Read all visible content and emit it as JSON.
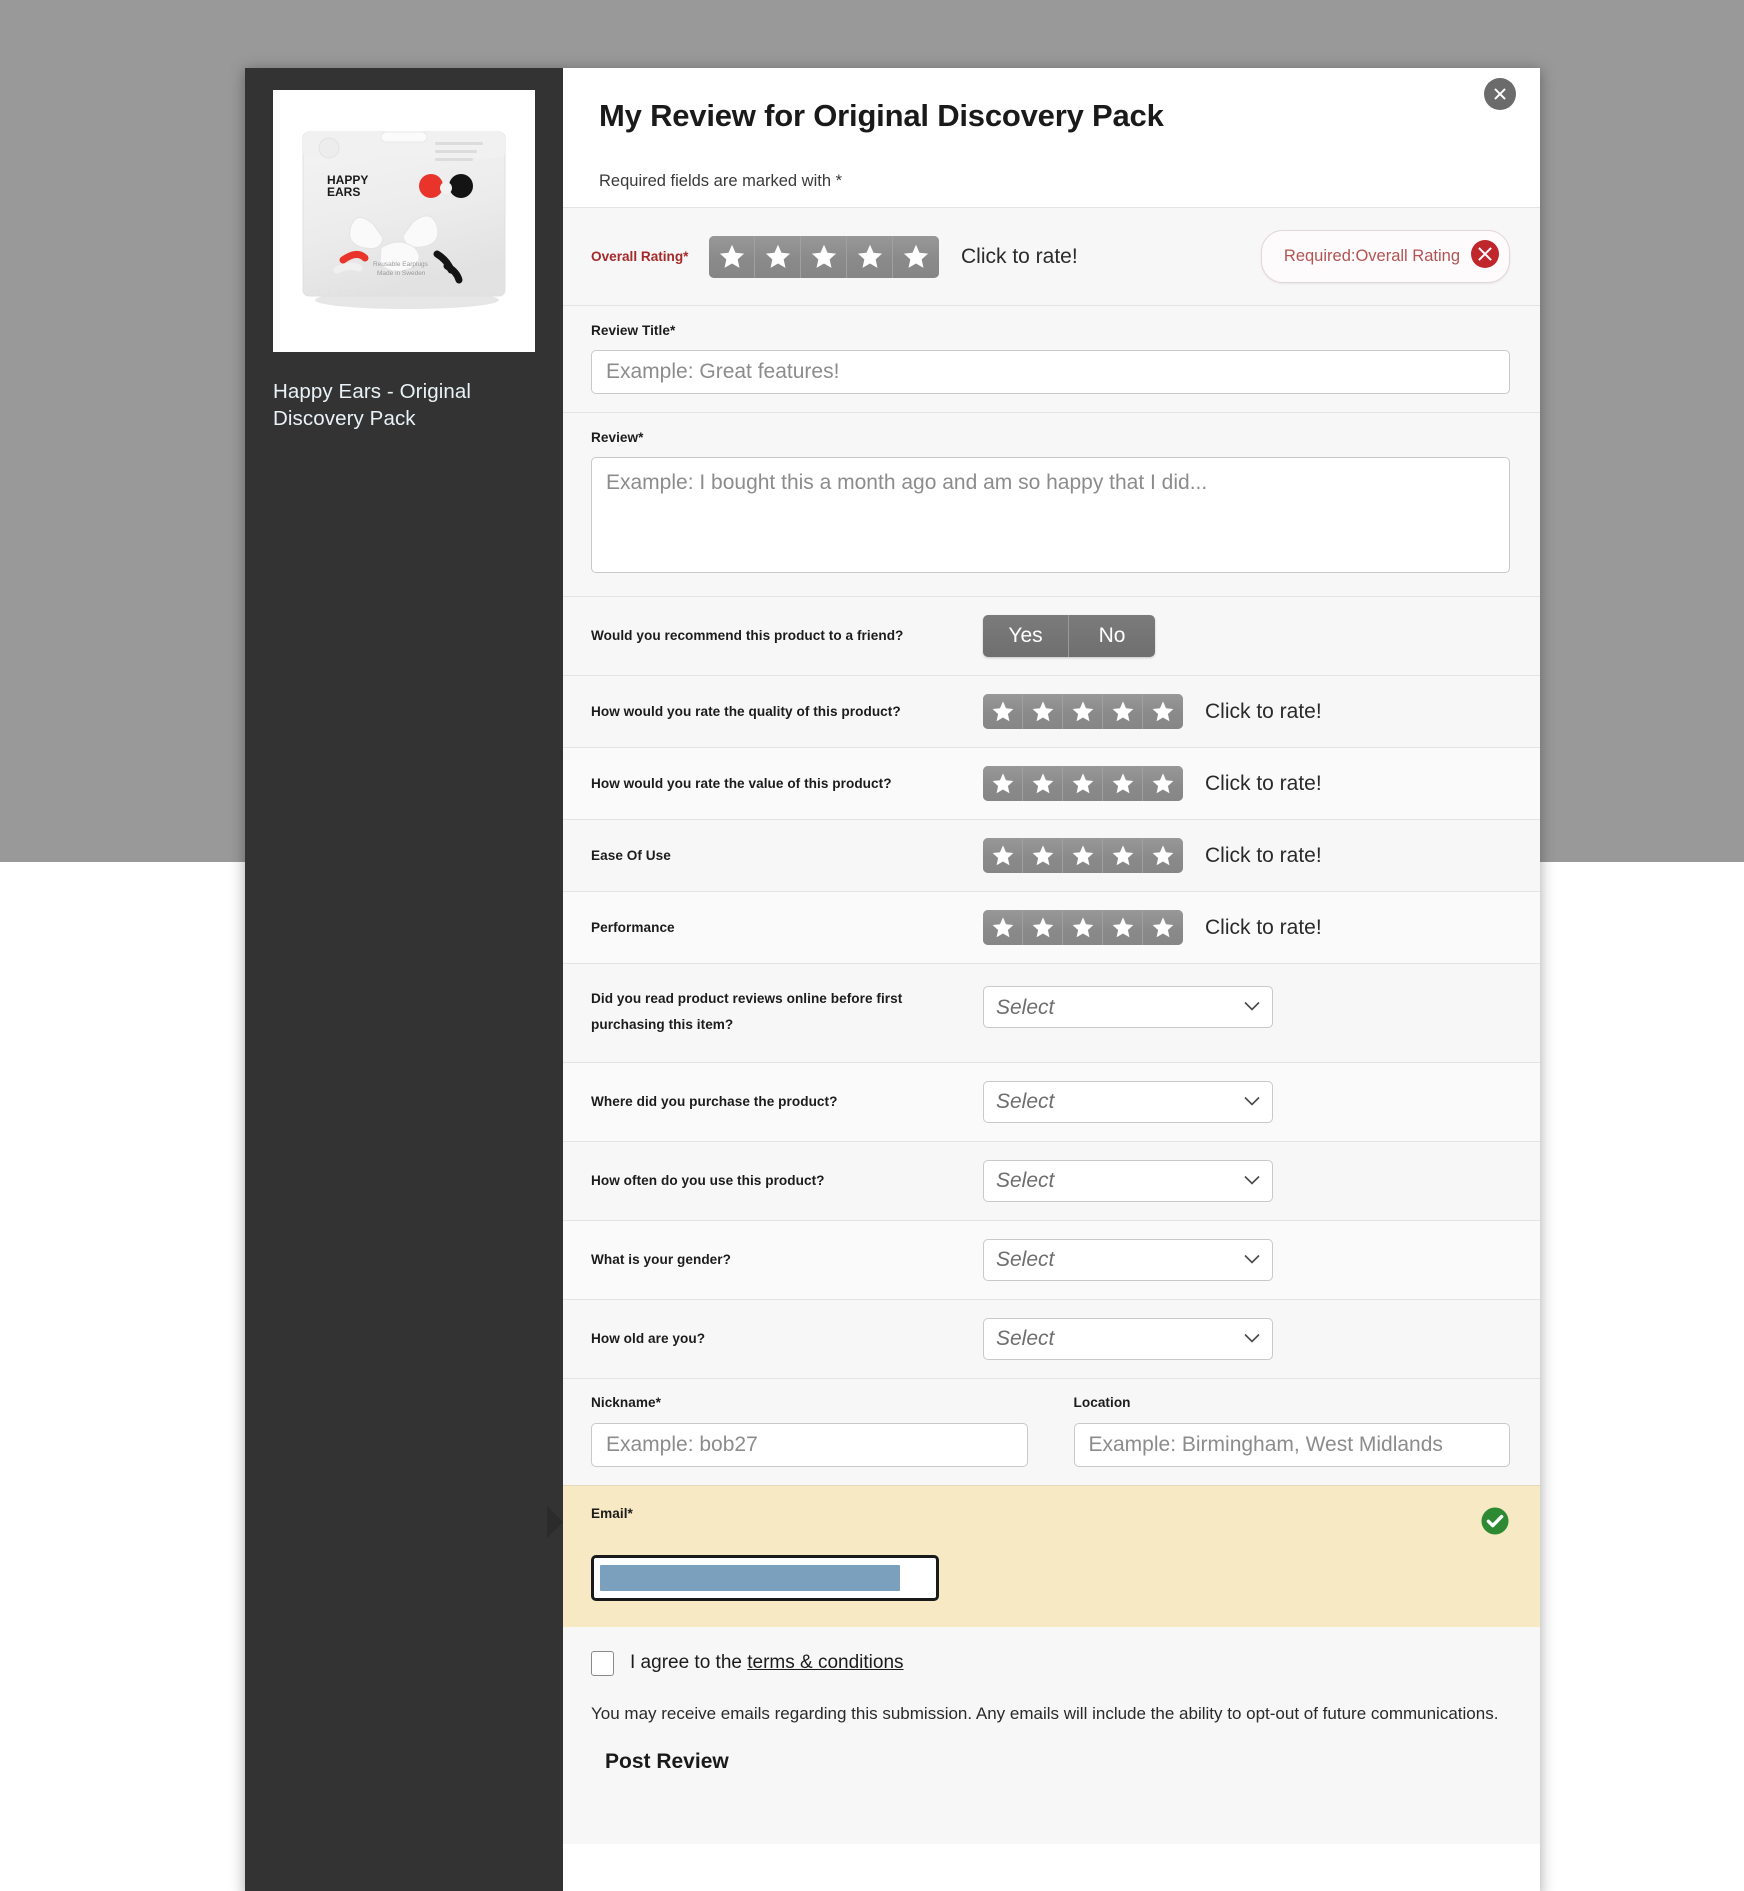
{
  "overlay": {
    "dim_color": "#999999",
    "sidebar_color": "#333333"
  },
  "modal": {
    "close_icon": "close-circle-icon",
    "title": "My Review for Original Discovery Pack",
    "required_note": "Required fields are marked with *"
  },
  "product": {
    "image_alt": "Happy Ears Original Discovery Pack resealable earplug pouch",
    "brand_mark": "HAPPY EARS",
    "package_text": "Reusable Earplugs Made in Sweden",
    "title": "Happy Ears - Original Discovery Pack"
  },
  "overall_rating": {
    "label": "Overall Rating",
    "required_mark": "*",
    "stars": 5,
    "filled": 0,
    "hint": "Click to rate!",
    "error_text": "Required:Overall Rating",
    "error_icon": "error-circle-icon",
    "label_color": "#a5292b",
    "error_color": "#b35454"
  },
  "review_title": {
    "label": "Review Title",
    "required_mark": "*",
    "placeholder": "Example: Great features!",
    "value": ""
  },
  "review_body": {
    "label": "Review",
    "required_mark": "*",
    "placeholder": "Example: I bought this a month ago and am so happy that I did...",
    "value": ""
  },
  "recommend": {
    "question": "Would you recommend this product to a friend?",
    "yes_label": "Yes",
    "no_label": "No"
  },
  "secondary_ratings": [
    {
      "label": "How would you rate the quality of this product?",
      "stars": 5,
      "filled": 0,
      "hint": "Click to rate!"
    },
    {
      "label": "How would you rate the value of this product?",
      "stars": 5,
      "filled": 0,
      "hint": "Click to rate!"
    },
    {
      "label": "Ease Of Use",
      "stars": 5,
      "filled": 0,
      "hint": "Click to rate!"
    },
    {
      "label": "Performance",
      "stars": 5,
      "filled": 0,
      "hint": "Click to rate!"
    }
  ],
  "selects": [
    {
      "label": "Did you read product reviews online before first purchasing this item?",
      "value": "Select"
    },
    {
      "label": "Where did you purchase the product?",
      "value": "Select"
    },
    {
      "label": "How often do you use this product?",
      "value": "Select"
    },
    {
      "label": "What is your gender?",
      "value": "Select"
    },
    {
      "label": "How old are you?",
      "value": "Select"
    }
  ],
  "nickname": {
    "label": "Nickname",
    "required_mark": "*",
    "placeholder": "Example: bob27",
    "value": ""
  },
  "location": {
    "label": "Location",
    "required_mark": "",
    "placeholder": "Example: Birmingham, West Midlands",
    "value": ""
  },
  "email": {
    "label": "Email",
    "required_mark": "*",
    "value": "",
    "selected_text_highlighted": true,
    "valid_icon": "check-circle-icon",
    "valid_color": "#2d8a33",
    "highlight_color": "#f7e9c3",
    "selection_color": "#7ba0bd"
  },
  "terms": {
    "prefix": "I agree to the ",
    "link_text": "terms & conditions",
    "checked": false
  },
  "disclaimer": "You may receive emails regarding this submission. Any emails will include the ability to opt-out of future communications.",
  "submit": {
    "label": "Post Review"
  }
}
